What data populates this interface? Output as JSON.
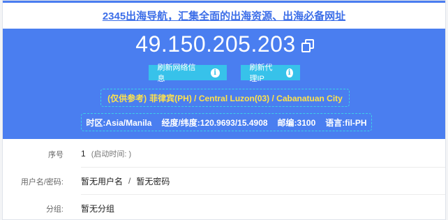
{
  "header": {
    "link_text": "2345出海导航，汇集全面的出海资源、出海必备网址",
    "link_color": "#3c6ee8"
  },
  "hero": {
    "bg_color": "#4a7ef0",
    "ip": "49.150.205.203",
    "copy_icon": "copy-icon",
    "buttons": [
      {
        "label": "刷新网络信息",
        "icon": "info-icon"
      },
      {
        "label": "刷新代理IP",
        "icon": "info-icon"
      }
    ],
    "location": {
      "note": "(仅供参考)",
      "text": "菲律宾(PH) / Central Luzon(03) / Cabanatuan City",
      "color": "#ffe24a"
    },
    "details": {
      "timezone": "时区:Asia/Manila",
      "coords": "经度/纬度:120.9693/15.4908",
      "postal": "邮编:3100",
      "language": "语言:fil-PH"
    }
  },
  "info_rows": {
    "seq": {
      "label": "序号",
      "value": "1",
      "extra": "(启动时间: )"
    },
    "credentials": {
      "label": "用户名/密码:",
      "username": "暂无用户名",
      "separator": "/",
      "password": "暂无密码"
    },
    "group": {
      "label": "分组:",
      "value": "暂无分组"
    }
  }
}
